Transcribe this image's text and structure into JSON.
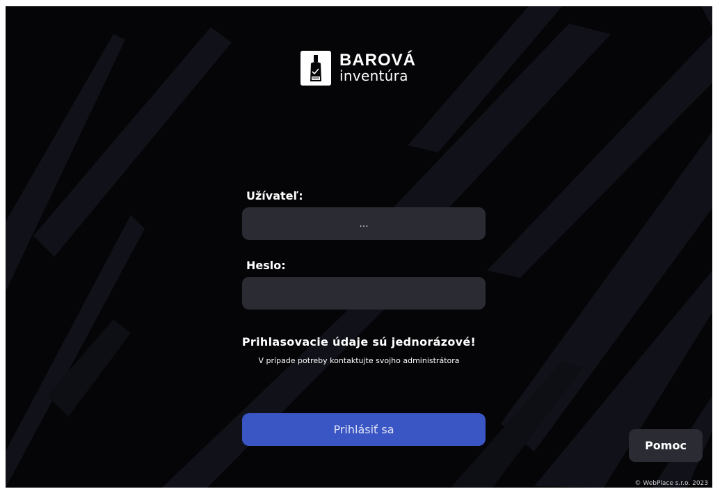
{
  "app": {
    "logo_title": "BAROVÁ",
    "logo_subtitle": "inventúra",
    "logo_icon": "bottle-icon"
  },
  "form": {
    "user_label": "Užívateľ:",
    "user_value": "...",
    "password_label": "Heslo:",
    "password_value": "",
    "login_label": "Prihlásiť sa"
  },
  "notice": {
    "title": "Prihlasovacie údaje sú jednorázové!",
    "subtitle": "V prípade potreby kontaktujte svojho administrátora"
  },
  "help_label": "Pomoc",
  "copyright": "© WebPlace s.r.o. 2023",
  "colors": {
    "background": "#050507",
    "stripe": "#111219",
    "input": "#2b2c33",
    "primary": "#3a55c4"
  }
}
